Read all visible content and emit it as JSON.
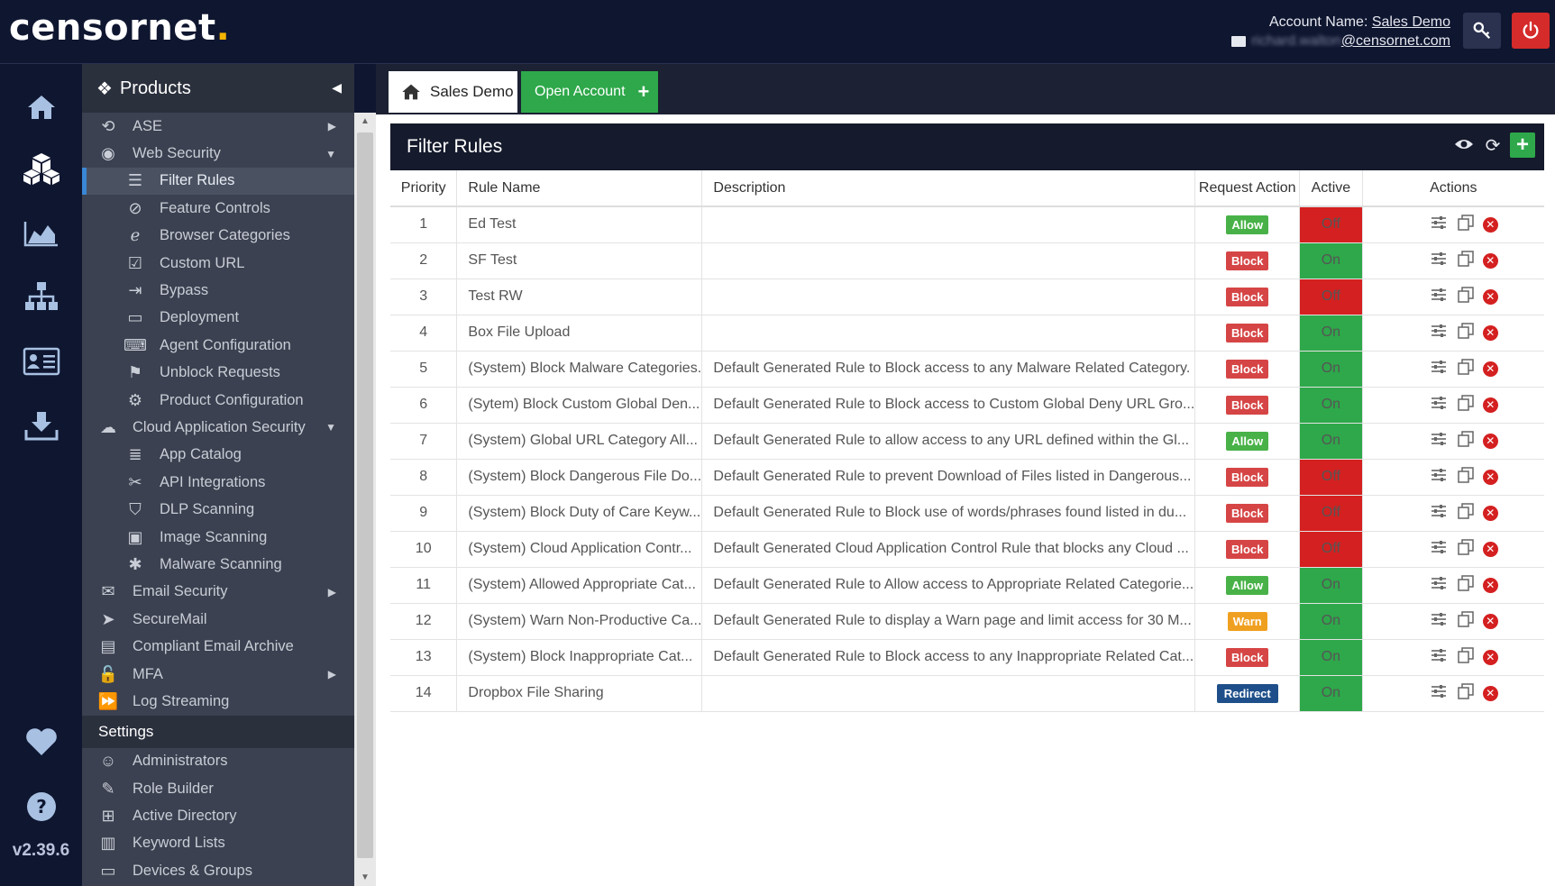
{
  "brand": {
    "logo": "censornet",
    "logo_dot": "."
  },
  "account": {
    "label": "Account Name:",
    "name": "Sales Demo",
    "email_hidden": "richard.walton",
    "email_domain": "@censornet.com"
  },
  "rail": {
    "items": [
      "home-icon",
      "products-icon",
      "reports-icon",
      "network-icon",
      "directory-icon",
      "download-icon"
    ],
    "bottom": [
      "heart-icon",
      "help-icon"
    ],
    "version": "v2.39.6"
  },
  "sidebar": {
    "title": "Products",
    "items": [
      {
        "label": "ASE",
        "icon": "⟲",
        "level": 1,
        "arrow": "▶"
      },
      {
        "label": "Web Security",
        "icon": "◉",
        "level": 1,
        "arrow": "▼"
      },
      {
        "label": "Filter Rules",
        "icon": "☰",
        "level": 2,
        "active": true
      },
      {
        "label": "Feature Controls",
        "icon": "⊘",
        "level": 2
      },
      {
        "label": "Browser Categories",
        "icon": "ℯ",
        "level": 2
      },
      {
        "label": "Custom URL",
        "icon": "☑",
        "level": 2
      },
      {
        "label": "Bypass",
        "icon": "⇥",
        "level": 2
      },
      {
        "label": "Deployment",
        "icon": "▭",
        "level": 2
      },
      {
        "label": "Agent Configuration",
        "icon": "⌨",
        "level": 2
      },
      {
        "label": "Unblock Requests",
        "icon": "⚑",
        "level": 2
      },
      {
        "label": "Product Configuration",
        "icon": "⚙",
        "level": 2
      },
      {
        "label": "Cloud Application Security",
        "icon": "☁",
        "level": 1,
        "arrow": "▼"
      },
      {
        "label": "App Catalog",
        "icon": "≣",
        "level": 2
      },
      {
        "label": "API Integrations",
        "icon": "✂",
        "level": 2
      },
      {
        "label": "DLP Scanning",
        "icon": "⛉",
        "level": 2
      },
      {
        "label": "Image Scanning",
        "icon": "▣",
        "level": 2
      },
      {
        "label": "Malware Scanning",
        "icon": "✱",
        "level": 2
      },
      {
        "label": "Email Security",
        "icon": "✉",
        "level": 1,
        "arrow": "▶"
      },
      {
        "label": "SecureMail",
        "icon": "➤",
        "level": 1
      },
      {
        "label": "Compliant Email Archive",
        "icon": "▤",
        "level": 1
      },
      {
        "label": "MFA",
        "icon": "🔓",
        "level": 1,
        "arrow": "▶"
      },
      {
        "label": "Log Streaming",
        "icon": "⏩",
        "level": 1
      }
    ],
    "settings_title": "Settings",
    "settings_items": [
      {
        "label": "Administrators",
        "icon": "☺"
      },
      {
        "label": "Role Builder",
        "icon": "✎"
      },
      {
        "label": "Active Directory",
        "icon": "⊞"
      },
      {
        "label": "Keyword Lists",
        "icon": "▥"
      },
      {
        "label": "Devices & Groups",
        "icon": "▭"
      }
    ]
  },
  "tabs": {
    "home_label": "Sales Demo",
    "open_label": "Open Account"
  },
  "panel": {
    "title": "Filter Rules",
    "columns": [
      "Priority",
      "Rule Name",
      "Description",
      "Request Action",
      "Active",
      "Actions"
    ],
    "rows": [
      {
        "priority": "1",
        "name": "Ed Test",
        "description": "",
        "action": "Allow",
        "active": "Off"
      },
      {
        "priority": "2",
        "name": "SF Test",
        "description": "",
        "action": "Block",
        "active": "On"
      },
      {
        "priority": "3",
        "name": "Test RW",
        "description": "",
        "action": "Block",
        "active": "Off"
      },
      {
        "priority": "4",
        "name": "Box File Upload",
        "description": "",
        "action": "Block",
        "active": "On"
      },
      {
        "priority": "5",
        "name": "(System) Block Malware Categories.",
        "description": "Default Generated Rule to Block access to any Malware Related Category.",
        "action": "Block",
        "active": "On"
      },
      {
        "priority": "6",
        "name": "(Sytem) Block Custom Global Den...",
        "description": "Default Generated Rule to Block access to Custom Global Deny URL Gro...",
        "action": "Block",
        "active": "On"
      },
      {
        "priority": "7",
        "name": "(System) Global URL Category All...",
        "description": "Default Generated Rule to allow access to any URL defined within the Gl...",
        "action": "Allow",
        "active": "On"
      },
      {
        "priority": "8",
        "name": "(System) Block Dangerous File Do...",
        "description": "Default Generated Rule to prevent Download of Files listed in Dangerous...",
        "action": "Block",
        "active": "Off"
      },
      {
        "priority": "9",
        "name": "(System) Block Duty of Care Keyw...",
        "description": "Default Generated Rule to Block use of words/phrases found listed in du...",
        "action": "Block",
        "active": "Off"
      },
      {
        "priority": "10",
        "name": "(System) Cloud Application Contr...",
        "description": "Default Generated Cloud Application Control Rule that blocks any Cloud ...",
        "action": "Block",
        "active": "Off"
      },
      {
        "priority": "11",
        "name": "(System) Allowed Appropriate Cat...",
        "description": "Default Generated Rule to Allow access to Appropriate Related Categorie...",
        "action": "Allow",
        "active": "On"
      },
      {
        "priority": "12",
        "name": "(System) Warn Non-Productive Ca...",
        "description": "Default Generated Rule to display a Warn page and limit access for 30 M...",
        "action": "Warn",
        "active": "On"
      },
      {
        "priority": "13",
        "name": "(System) Block Inappropriate Cat...",
        "description": "Default Generated Rule to Block access to any Inappropriate Related Cat...",
        "action": "Block",
        "active": "On"
      },
      {
        "priority": "14",
        "name": "Dropbox File Sharing",
        "description": "",
        "action": "Redirect",
        "active": "On"
      }
    ]
  },
  "colors": {
    "allow": "#48b248",
    "block": "#d64545",
    "warn": "#f0a020",
    "redirect": "#1f4f8a",
    "on": "#2ea84a",
    "off": "#d42020",
    "nav_bg": "#0f1630",
    "sidebar_bg": "#3b4150"
  }
}
